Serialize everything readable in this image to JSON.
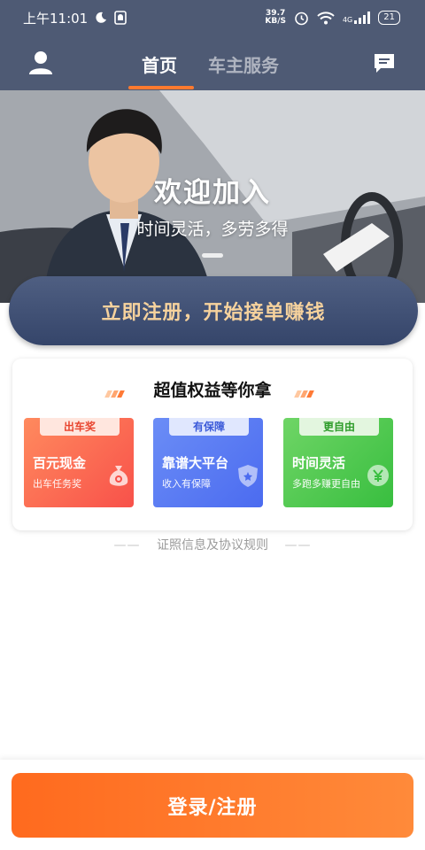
{
  "status_bar": {
    "time": "上午11:01",
    "net_speed_value": "39.7",
    "net_speed_unit": "KB/S",
    "network": "4G",
    "battery": "21"
  },
  "nav": {
    "tabs": [
      {
        "label": "首页",
        "active": true
      },
      {
        "label": "车主服务",
        "active": false
      }
    ],
    "icons": {
      "left": "user-icon",
      "right": "message-icon"
    }
  },
  "hero": {
    "title": "欢迎加入",
    "subtitle": "时间灵活，多劳多得"
  },
  "register_button": {
    "label": "立即注册，开始接单赚钱"
  },
  "benefits": {
    "title": "超值权益等你拿",
    "items": [
      {
        "badge": "出车奖",
        "title": "百元现金",
        "subtitle": "出车任务奖",
        "icon": "money-bag-icon",
        "color": "#f8514a"
      },
      {
        "badge": "有保障",
        "title": "靠谱大平台",
        "subtitle": "收入有保障",
        "icon": "shield-icon",
        "color": "#4b6bf0"
      },
      {
        "badge": "更自由",
        "title": "时间灵活",
        "subtitle": "多跑多赚更自由",
        "icon": "coin-icon",
        "color": "#38be3f"
      }
    ]
  },
  "footer_link": {
    "dash_left": "——",
    "label": "证照信息及协议规则",
    "dash_right": "——"
  },
  "login_button": {
    "label": "登录/注册"
  },
  "colors": {
    "nav_bg": "#4e5a74",
    "accent": "#ff7a2f",
    "register_text": "#f6d29d"
  }
}
